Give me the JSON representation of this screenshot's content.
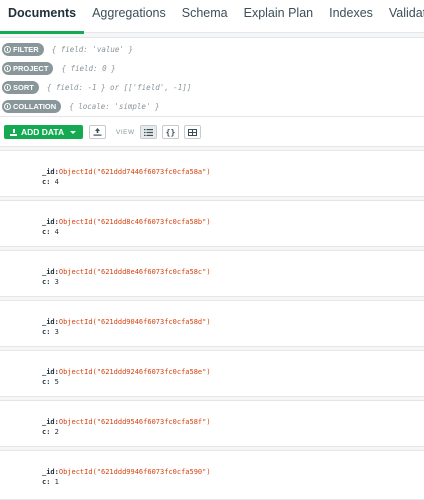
{
  "tabs": [
    {
      "label": "Documents",
      "active": true
    },
    {
      "label": "Aggregations",
      "active": false
    },
    {
      "label": "Schema",
      "active": false
    },
    {
      "label": "Explain Plan",
      "active": false
    },
    {
      "label": "Indexes",
      "active": false
    },
    {
      "label": "Validation",
      "active": false
    }
  ],
  "query": {
    "filter": {
      "label": "FILTER",
      "placeholder": "{ field: 'value' }"
    },
    "project": {
      "label": "PROJECT",
      "placeholder": "{ field: 0 }"
    },
    "sort": {
      "label": "SORT",
      "placeholder": "{ field: -1 } or [['field', -1]]"
    },
    "collation": {
      "label": "COLLATION",
      "placeholder": "{ locale: 'simple' }"
    }
  },
  "toolbar": {
    "add_data_label": "ADD DATA",
    "view_label": "VIEW",
    "icons": [
      "download-icon",
      "export-icon",
      "list-view-icon",
      "json-view-icon",
      "table-view-icon"
    ]
  },
  "documents": [
    {
      "id_key": "_id:",
      "id_value": "ObjectId(\"621ddd7446f6073fc0cfa58a\")",
      "c_key": "c:",
      "c_value": "4"
    },
    {
      "id_key": "_id:",
      "id_value": "ObjectId(\"621ddd8c46f6073fc0cfa58b\")",
      "c_key": "c:",
      "c_value": "4"
    },
    {
      "id_key": "_id:",
      "id_value": "ObjectId(\"621ddd8e46f6073fc0cfa58c\")",
      "c_key": "c:",
      "c_value": "3"
    },
    {
      "id_key": "_id:",
      "id_value": "ObjectId(\"621ddd9046f6073fc0cfa58d\")",
      "c_key": "c:",
      "c_value": "3"
    },
    {
      "id_key": "_id:",
      "id_value": "ObjectId(\"621ddd9246f6073fc0cfa58e\")",
      "c_key": "c:",
      "c_value": "5"
    },
    {
      "id_key": "_id:",
      "id_value": "ObjectId(\"621ddd9546f6073fc0cfa58f\")",
      "c_key": "c:",
      "c_value": "2"
    },
    {
      "id_key": "_id:",
      "id_value": "ObjectId(\"621ddd9946f6073fc0cfa590\")",
      "c_key": "c:",
      "c_value": "1"
    }
  ],
  "colors": {
    "accent": "#13aa52",
    "oid": "#d5410f",
    "badge": "#89979b"
  }
}
